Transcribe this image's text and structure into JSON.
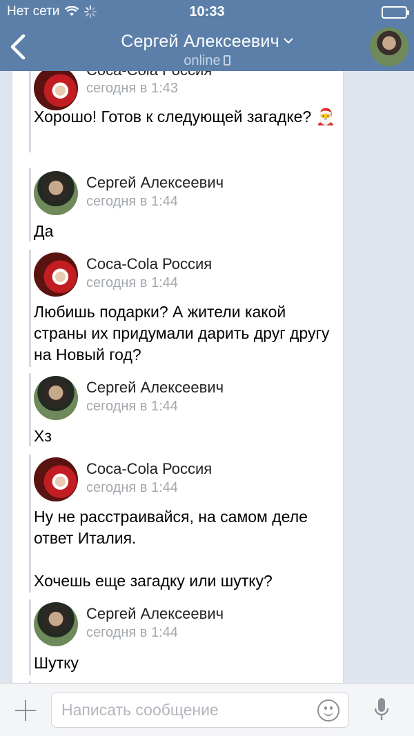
{
  "status_bar": {
    "carrier": "Нет сети",
    "time": "10:33"
  },
  "header": {
    "title": "Сергей Алексеевич",
    "subtitle": "online"
  },
  "colors": {
    "header_bg": "#5b7fa8",
    "chat_bg": "#ffffff",
    "bar": "#d5dbe4",
    "time_text": "#a3a8ae"
  },
  "messages": [
    {
      "author": "Coca-Cola Россия",
      "time": "сегодня в 1:43",
      "text": "Хорошо! Готов к следующей загадке? 🎅",
      "avatar": "coca-cola-santa"
    },
    {
      "author": "Сергей Алексеевич",
      "time": "сегодня в 1:44",
      "text": "Да",
      "avatar": "sergey"
    },
    {
      "author": "Coca-Cola Россия",
      "time": "сегодня в 1:44",
      "text": "Любишь подарки? А жители какой страны их придумали дарить друг другу на Новый год?",
      "avatar": "coca-cola-santa"
    },
    {
      "author": "Сергей Алексеевич",
      "time": "сегодня в 1:44",
      "text": "Хз",
      "avatar": "sergey"
    },
    {
      "author": "Coca-Cola Россия",
      "time": "сегодня в 1:44",
      "text": "Ну не расстраивайся, на самом деле ответ Италия.\n\nХочешь еще загадку или шутку?",
      "avatar": "coca-cola-santa"
    },
    {
      "author": "Сергей Алексеевич",
      "time": "сегодня в 1:44",
      "text": "Шутку",
      "avatar": "sergey"
    }
  ],
  "input": {
    "placeholder": "Написать сообщение"
  },
  "icons": [
    "back-icon",
    "chevron-down-icon",
    "phone-icon",
    "plus-icon",
    "emoji-icon",
    "microphone-icon",
    "wifi-icon",
    "spinner-icon",
    "battery-icon"
  ]
}
